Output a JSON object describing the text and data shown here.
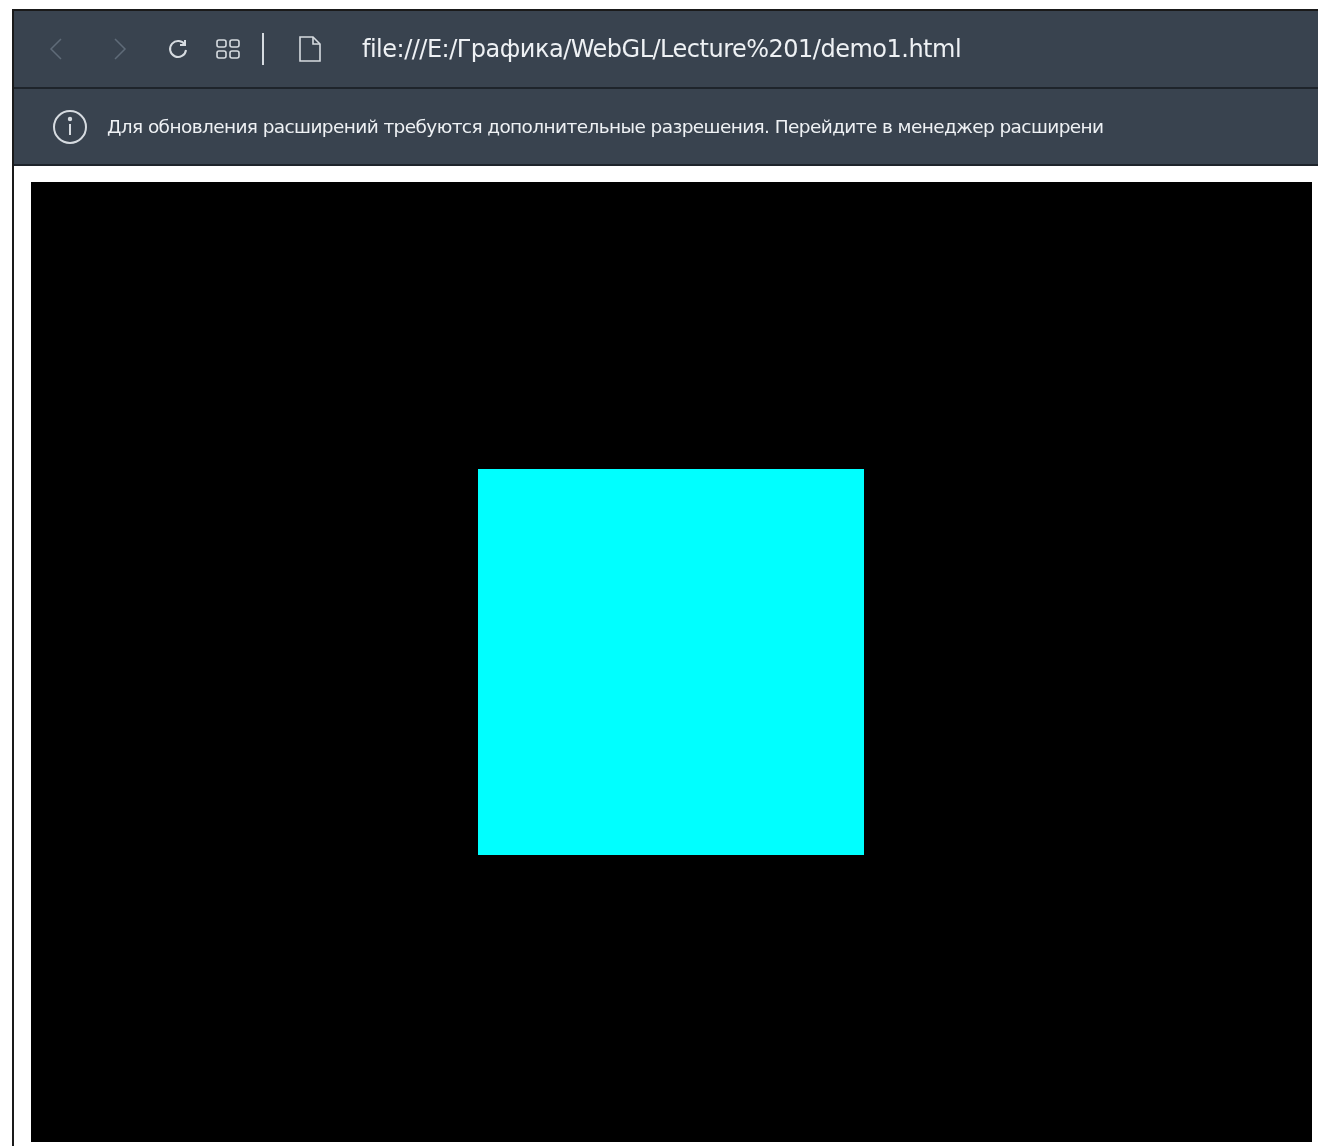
{
  "toolbar": {
    "back_disabled": true,
    "forward_disabled": true,
    "url": "file:///E:/Графика/WebGL/Lecture%201/demo1.html"
  },
  "infobar": {
    "message": "Для обновления расширений требуются дополнительные разрешения. Перейдите в менеджер расширени"
  }
}
